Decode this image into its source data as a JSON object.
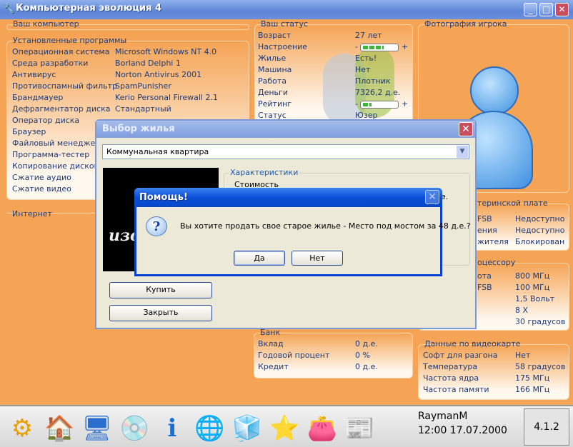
{
  "window": {
    "title": "Компьютерная эволюция 4"
  },
  "computer": {
    "title": "Ваш компьютер",
    "programs_title": "Установленные программы",
    "programs": [
      [
        "Операционная система",
        "Microsoft Windows NT 4.0"
      ],
      [
        "Среда разработки",
        "Borland Delphi 1"
      ],
      [
        "Антивирус",
        "Norton Antivirus 2001"
      ],
      [
        "Противоспамный фильтр",
        "SpamPunisher"
      ],
      [
        "Брандмауер",
        "Kerio Personal Firewall 2.1"
      ],
      [
        "Дефрагментатор диска",
        "Стандартный"
      ],
      [
        "Оператор диска",
        ""
      ],
      [
        "Браузер",
        ""
      ],
      [
        "Файловый менеджер",
        ""
      ],
      [
        "Программа-тестер",
        ""
      ],
      [
        "Копирование дисков",
        ""
      ],
      [
        "Сжатие аудио",
        ""
      ],
      [
        "Сжатие видео",
        ""
      ]
    ],
    "internet_title": "Интернет"
  },
  "status": {
    "title": "Ваш статус",
    "rows": [
      [
        "Возраст",
        "27 лет"
      ],
      [
        "Настроение",
        ""
      ],
      [
        "Жилье",
        "Есть!"
      ],
      [
        "Машина",
        "Нет"
      ],
      [
        "Работа",
        "Плотник"
      ],
      [
        "Деньги",
        "7326,2 д.е."
      ],
      [
        "Рейтинг",
        ""
      ],
      [
        "Статус",
        "Юзер"
      ]
    ],
    "mood_level": 0.6,
    "rating_level": 0.25,
    "minus": "-",
    "plus": "+"
  },
  "photo": {
    "title": "Фотография игрока"
  },
  "motherboard": {
    "title_fragment": "теринской плате",
    "rows": [
      [
        "FSB",
        "Недоступно"
      ],
      [
        "ения",
        "Недоступно"
      ],
      [
        "жителя",
        "Блокирован"
      ]
    ]
  },
  "cpu": {
    "title_fragment": "оцессору",
    "rows": [
      [
        "ота",
        "800 МГц"
      ],
      [
        "FSB",
        "100 МГц"
      ],
      [
        "",
        "1,5 Вольт"
      ],
      [
        "",
        "8 X"
      ],
      [
        "",
        "30 градусов"
      ]
    ]
  },
  "video": {
    "title": "Данные по видеокарте",
    "rows": [
      [
        "Софт для разгона",
        "Нет"
      ],
      [
        "Температура",
        "58 градусов"
      ],
      [
        "Частота ядра",
        "175 МГц"
      ],
      [
        "Частота памяти",
        "166 МГц"
      ]
    ]
  },
  "bank": {
    "title": "Банк",
    "rows": [
      [
        "Вклад",
        "0 д.е."
      ],
      [
        "Годовой процент",
        "0 %"
      ],
      [
        "Кредит",
        "0 д.е."
      ]
    ]
  },
  "housing_dialog": {
    "title": "Выбор жилья",
    "selected": "Коммунальная квартира",
    "image_text": "изо",
    "char_title": "Характеристики",
    "char_cost": "Стоимость",
    "char_fragment": "е.",
    "buy": "Купить",
    "close": "Закрыть"
  },
  "help_dialog": {
    "title": "Помощь!",
    "message": "Вы хотите продать свое старое жилье - Место под мостом за 48 д.е.?",
    "yes": "Да",
    "no": "Нет"
  },
  "taskbar": {
    "icons": [
      "kde-gear-icon",
      "home-icon",
      "computer-icon",
      "install-icon",
      "info-board-icon",
      "network-globe-icon",
      "cubes-icon",
      "star-icon",
      "wallet-icon",
      "newspaper-icon"
    ],
    "user": "RaymanM",
    "datetime": "12:00 17.07.2000",
    "version": "4.1.2"
  }
}
